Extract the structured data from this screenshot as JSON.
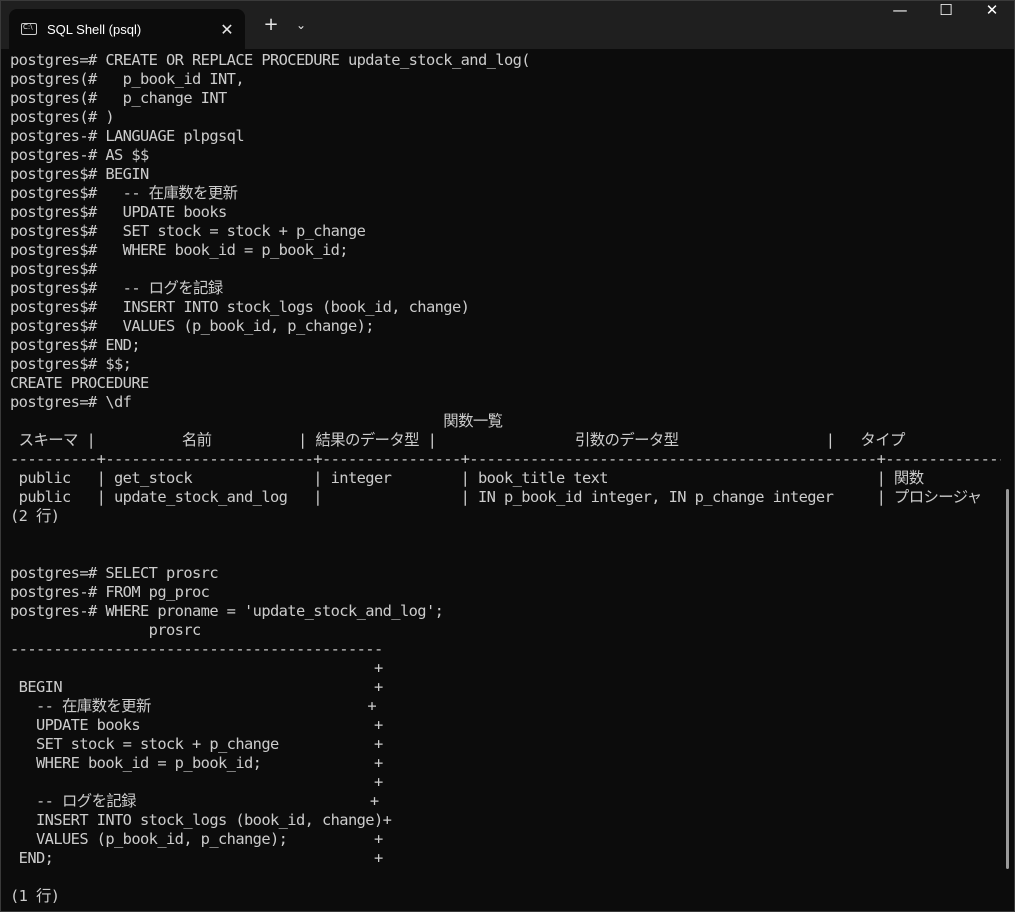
{
  "window": {
    "tab_title": "SQL Shell (psql)",
    "tab_close_glyph": "✕",
    "new_tab_glyph": "+",
    "dropdown_glyph": "⌄",
    "minimize_glyph": "—",
    "maximize_glyph": "☐",
    "close_glyph": "✕",
    "colors": {
      "background": "#0c0c0c",
      "titlebar": "#1f1f1f",
      "text": "#cccccc"
    }
  },
  "terminal": {
    "lines": [
      "postgres=# CREATE OR REPLACE PROCEDURE update_stock_and_log(",
      "postgres(#   p_book_id INT,",
      "postgres(#   p_change INT",
      "postgres(# )",
      "postgres-# LANGUAGE plpgsql",
      "postgres-# AS $$",
      "postgres$# BEGIN",
      "postgres$#   -- 在庫数を更新",
      "postgres$#   UPDATE books",
      "postgres$#   SET stock = stock + p_change",
      "postgres$#   WHERE book_id = p_book_id;",
      "postgres$#",
      "postgres$#   -- ログを記録",
      "postgres$#   INSERT INTO stock_logs (book_id, change)",
      "postgres$#   VALUES (p_book_id, p_change);",
      "postgres$# END;",
      "postgres$# $$;",
      "CREATE PROCEDURE",
      "postgres=# \\df",
      "                                                  関数一覧",
      " スキーマ |          名前          | 結果のデータ型 |                引数のデータ型                 |   タイプ",
      "----------+------------------------+----------------+-----------------------------------------------+--------------",
      " public   | get_stock              | integer        | book_title text                               | 関数",
      " public   | update_stock_and_log   |                | IN p_book_id integer, IN p_change integer     | プロシージャ",
      "(2 行)",
      "",
      "",
      "postgres=# SELECT prosrc",
      "postgres-# FROM pg_proc",
      "postgres-# WHERE proname = 'update_stock_and_log';",
      "                prosrc",
      "-------------------------------------------",
      "                                          +",
      " BEGIN                                    +",
      "   -- 在庫数を更新                         +",
      "   UPDATE books                           +",
      "   SET stock = stock + p_change           +",
      "   WHERE book_id = p_book_id;             +",
      "                                          +",
      "   -- ログを記録                           +",
      "   INSERT INTO stock_logs (book_id, change)+",
      "   VALUES (p_book_id, p_change);          +",
      " END;                                     +",
      "",
      "(1 行)"
    ]
  }
}
